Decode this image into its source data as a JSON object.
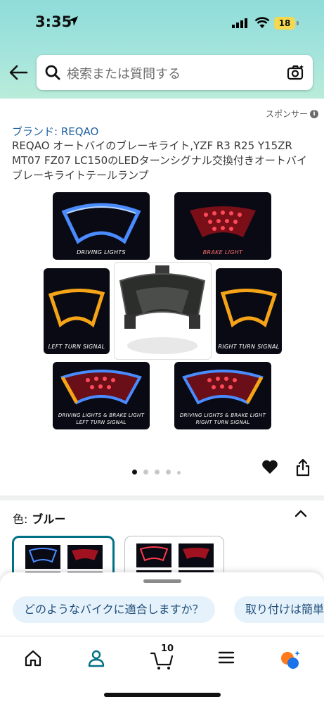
{
  "status_bar": {
    "time": "3:35",
    "battery": "18"
  },
  "search": {
    "placeholder": "検索または質問する"
  },
  "sponsored": {
    "label": "スポンサー"
  },
  "product": {
    "brand": "ブランド: REQAO",
    "title": "REQAO オートバイのブレーキライト,YZF R3 R25 Y15ZR MT07 FZ07 LC150のLEDターンシグナル交換付きオートバイブレーキライトテールランプ"
  },
  "gallery": {
    "captions": {
      "driving": "DRIVING LIGHTS",
      "brake": "BRAKE LIGHT",
      "left": "LEFT TURN SIGNAL",
      "right": "RIGHT TURN SIGNAL",
      "combo_left_1": "DRIVING LIGHTS & BRAKE LIGHT",
      "combo_left_2": "LEFT TURN SIGNAL",
      "combo_right_1": "DRIVING LIGHTS & BRAKE LIGHT",
      "combo_right_2": "RIGHT TURN SIGNAL"
    },
    "page_count": 5,
    "current_page": 1
  },
  "variation": {
    "label": "色:",
    "value": "ブルー"
  },
  "suggestions": [
    "どのようなバイクに適合しますか？",
    "取り付けは簡単"
  ],
  "nav": {
    "cart_count": "10"
  },
  "colors": {
    "link": "#2162a1",
    "accent": "#007185",
    "chip_bg": "#e6f2fb"
  }
}
